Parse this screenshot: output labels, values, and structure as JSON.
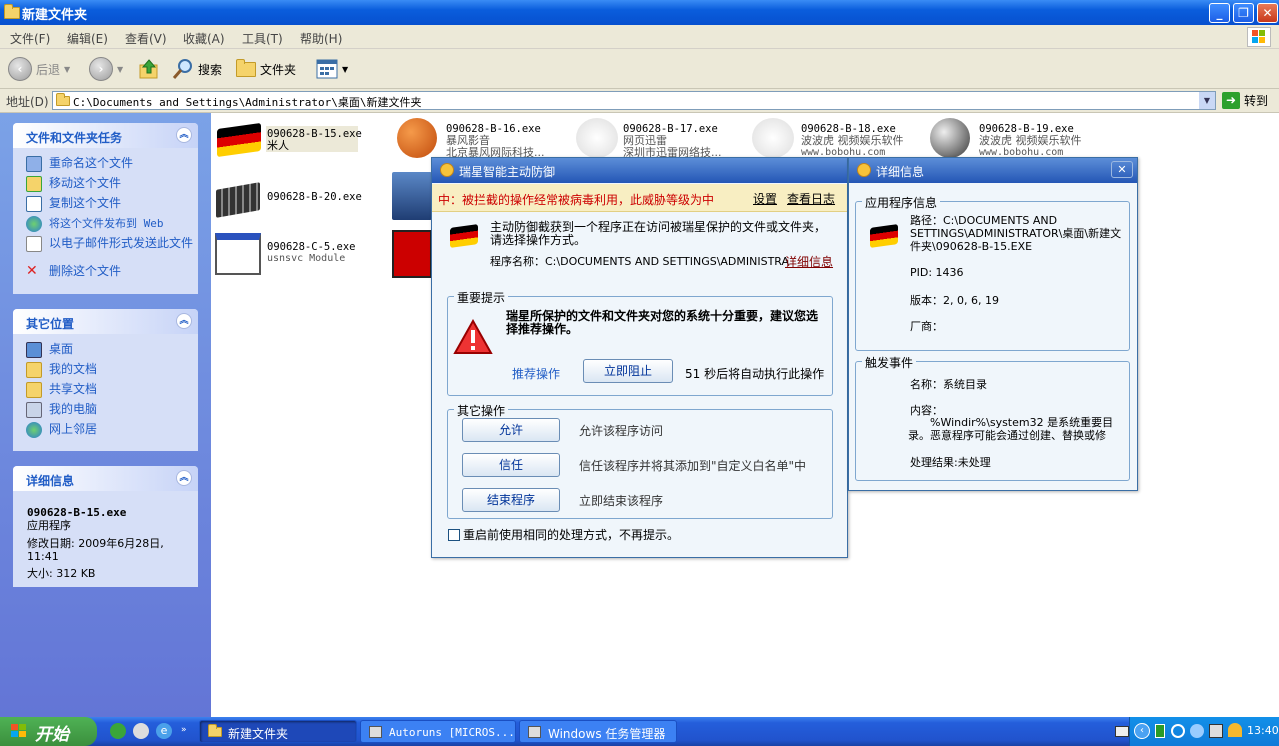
{
  "window": {
    "title": "新建文件夹"
  },
  "menu": [
    "文件(F)",
    "编辑(E)",
    "查看(V)",
    "收藏(A)",
    "工具(T)",
    "帮助(H)"
  ],
  "toolbar": {
    "back": "后退",
    "search": "搜索",
    "folders": "文件夹"
  },
  "address": {
    "label": "地址(D)",
    "path": "C:\\Documents and Settings\\Administrator\\桌面\\新建文件夹",
    "go": "转到"
  },
  "tasks_panel": {
    "title": "文件和文件夹任务",
    "items": [
      "重命名这个文件",
      "移动这个文件",
      "复制这个文件",
      "将这个文件发布到 Web",
      "以电子邮件形式发送此文件",
      "删除这个文件"
    ]
  },
  "places_panel": {
    "title": "其它位置",
    "items": [
      "桌面",
      "我的文档",
      "共享文档",
      "我的电脑",
      "网上邻居"
    ]
  },
  "details_panel": {
    "title": "详细信息",
    "filename": "090628-B-15.exe",
    "type": "应用程序",
    "modified": "修改日期: 2009年6月28日, 11:41",
    "size": "大小: 312 KB"
  },
  "files": [
    {
      "name": "090628-B-15.exe",
      "sub": "米人"
    },
    {
      "name": "090628-B-16.exe",
      "sub": "暴风影音",
      "sub2": "北京暴风网际科技..."
    },
    {
      "name": "090628-B-17.exe",
      "sub": "网页迅雷",
      "sub2": "深圳市迅雷网络技..."
    },
    {
      "name": "090628-B-18.exe",
      "sub": "波波虎 视频娱乐软件",
      "sub2": "www.bobohu.com"
    },
    {
      "name": "090628-B-19.exe",
      "sub": "波波虎 视频娱乐软件",
      "sub2": "www.bobohu.com"
    },
    {
      "name": "090628-B-20.exe",
      "sub": ""
    },
    {
      "name": "090628-C-5.exe",
      "sub": "usnsvc Module"
    }
  ],
  "rising": {
    "title": "瑞星智能主动防御",
    "threat": "中：被拦截的操作经常被病毒利用，此威胁等级为中",
    "settings": "设置",
    "log": "查看日志",
    "intro": "主动防御截获到一个程序正在访问被瑞星保护的文件或文件夹，请选择操作方式。",
    "program": "程序名称：C:\\DOCUMENTS AND SETTINGS\\ADMINISTRA",
    "details_link": "详细信息",
    "important_label": "重要提示",
    "important_text": "瑞星所保护的文件和文件夹对您的系统十分重要，建议您选择推荐操作。",
    "recommend": "推荐操作",
    "block_now": "立即阻止",
    "countdown": "51 秒后将自动执行此操作",
    "other_label": "其它操作",
    "allow": "允许",
    "allow_desc": "允许该程序访问",
    "trust": "信任",
    "trust_desc": "信任该程序并将其添加到\"自定义白名单\"中",
    "kill": "结束程序",
    "kill_desc": "立即结束该程序",
    "remember": "重启前使用相同的处理方式，不再提示。"
  },
  "detail": {
    "title": "详细信息",
    "app_label": "应用程序信息",
    "path": "路径：C:\\DOCUMENTS AND SETTINGS\\ADMINISTRATOR\\桌面\\新建文件夹\\090628-B-15.EXE",
    "pid": "PID: 1436",
    "version": "版本：2, 0, 6, 19",
    "vendor": "厂商：",
    "event_label": "触发事件",
    "event_name": "名称：系统目录",
    "content_label": "内容：",
    "content": "%Windir%\\system32 是系统重要目录。恶意程序可能会通过创建、替换或修",
    "result": "处理结果:未处理"
  },
  "taskbar": {
    "start": "开始",
    "tasks": [
      "新建文件夹",
      "Autoruns [MICROS...",
      "Windows 任务管理器"
    ],
    "clock": "13:40"
  }
}
